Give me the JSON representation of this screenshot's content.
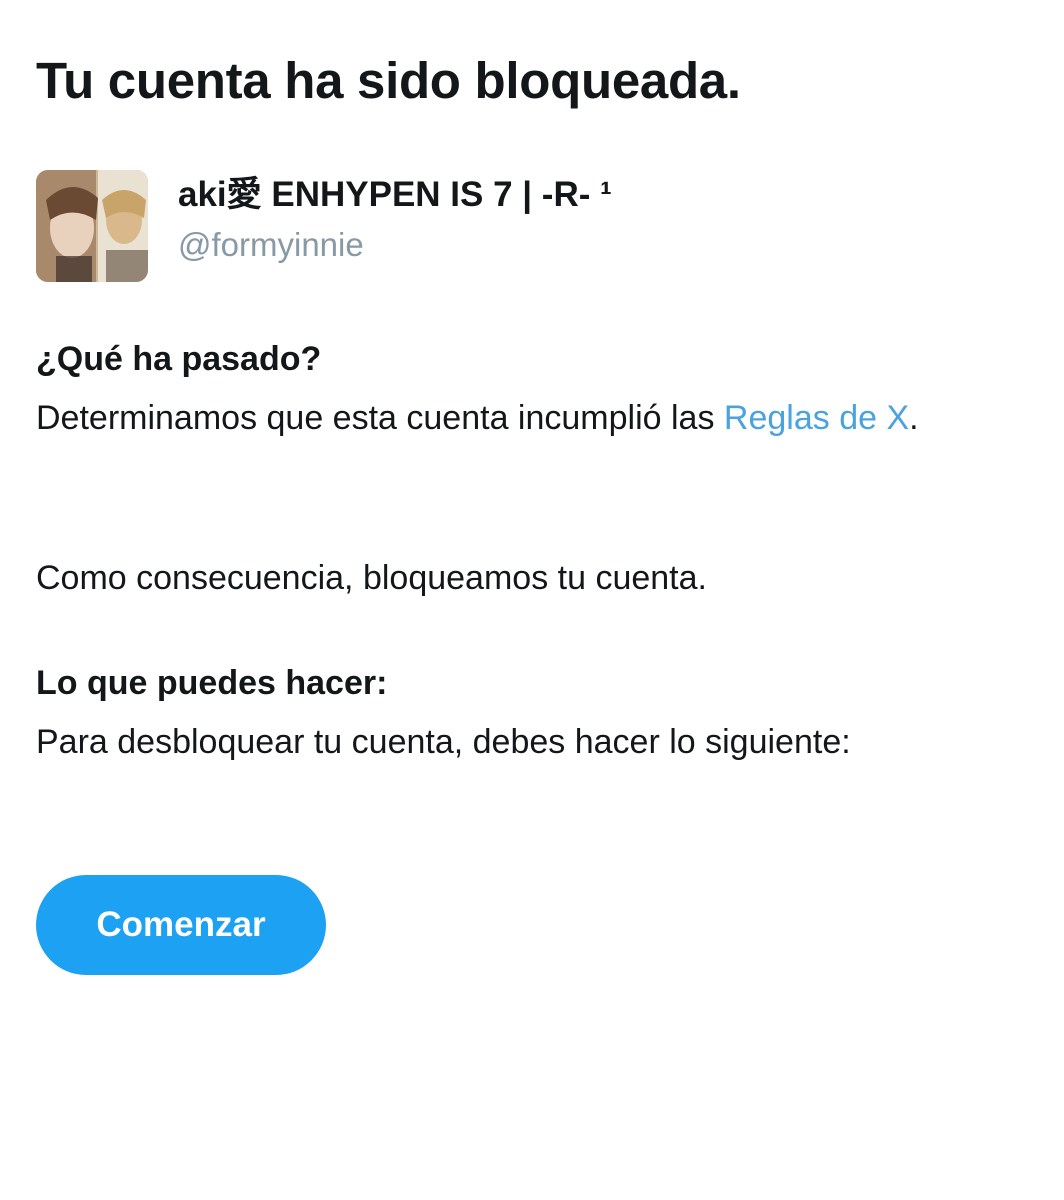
{
  "title": "Tu cuenta ha sido bloqueada.",
  "account": {
    "display_name": "aki愛 ENHYPEN IS 7 | -R- ¹",
    "handle": "@formyinnie"
  },
  "what_happened": {
    "heading": "¿Qué ha pasado?",
    "text_before_link": "Determinamos que esta cuenta incumplió las ",
    "link_text": "Reglas de X",
    "text_after_link": ".",
    "consequence": "Como consecuencia, bloqueamos tu cuenta."
  },
  "what_you_can_do": {
    "heading": "Lo que puedes hacer:",
    "text": "Para desbloquear tu cuenta, debes hacer lo siguiente:"
  },
  "start_button": {
    "label": "Comenzar"
  },
  "colors": {
    "text": "#14171a",
    "secondary_text": "#8899a6",
    "link": "#4aa3df",
    "button": "#1da1f2",
    "background": "#ffffff"
  }
}
